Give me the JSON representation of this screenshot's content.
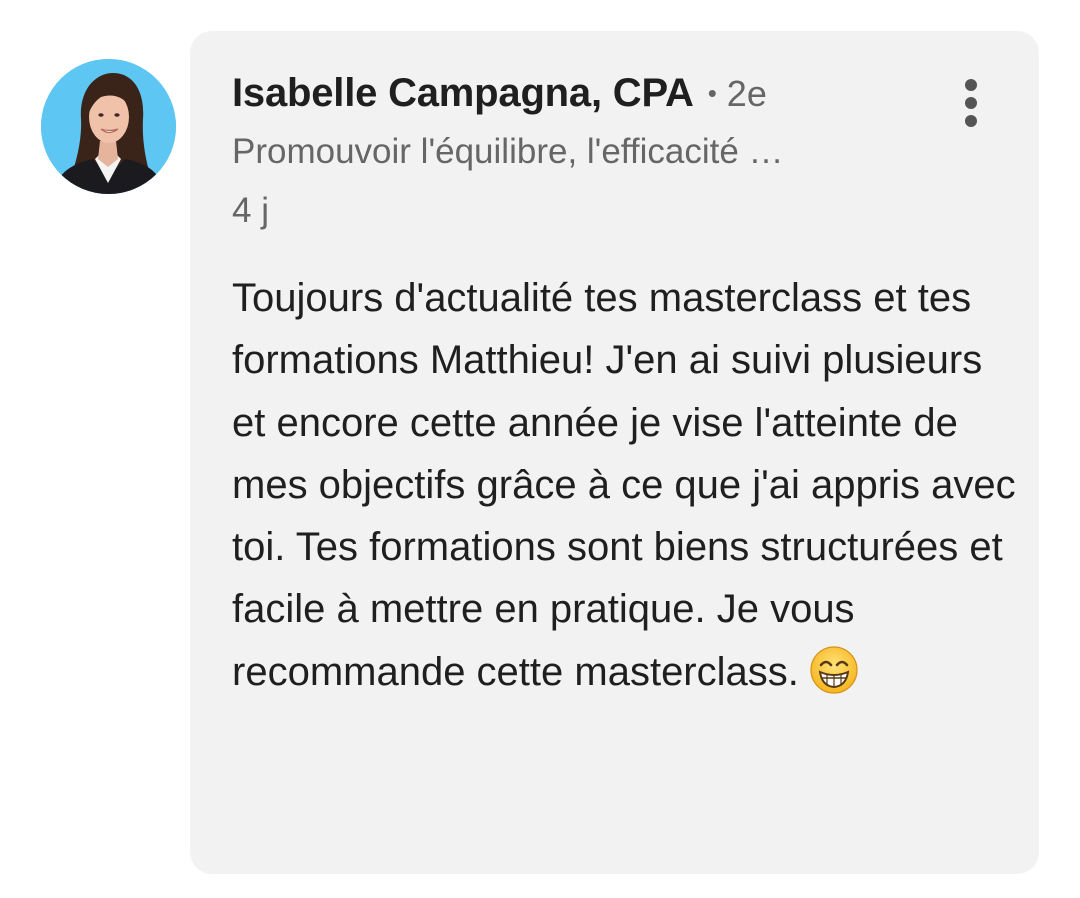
{
  "comment": {
    "author_name": "Isabelle Campagna, CPA",
    "separator": "•",
    "connection_degree": "2e",
    "headline": "Promouvoir l'équilibre, l'efficacité …",
    "timestamp": "4 j",
    "body": "Toujours d'actualité tes masterclass et tes formations Matthieu! J'en ai suivi plusieurs et encore cette année je vise l'atteinte de mes objectifs grâce à ce que j'ai appris avec toi. Tes formations sont biens structurées et facile à mettre en pratique. Je vous recommande cette masterclass.",
    "emoji": "grinning-face-with-smiling-eyes",
    "more_icon": "vertical-ellipsis-icon"
  },
  "colors": {
    "card_background": "#f2f2f2",
    "avatar_background": "#5ec6f2",
    "primary_text": "#1f1f1f",
    "secondary_text": "#666666"
  }
}
